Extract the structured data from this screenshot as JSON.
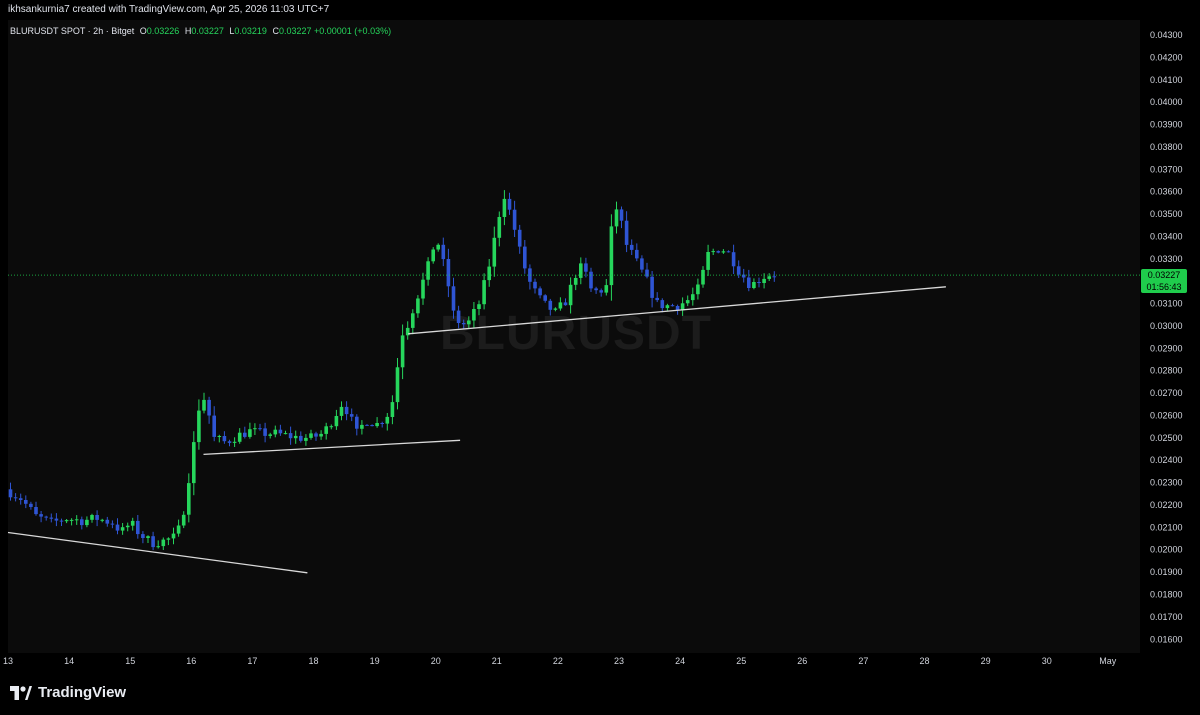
{
  "header": {
    "credit": "ikhsankurnia7 created with TradingView.com, Apr 25, 2026 11:03 UTC+7"
  },
  "legend": {
    "symbol": "BLURUSDT SPOT · 2h · Bitget",
    "open_label": "O",
    "open": "0.03226",
    "high_label": "H",
    "high": "0.03227",
    "low_label": "L",
    "low": "0.03219",
    "close_label": "C",
    "close": "0.03227",
    "change": "+0.00001 (+0.03%)"
  },
  "watermark": "BLURUSDT",
  "price_tag": {
    "price": "0.03227",
    "countdown": "01:56:43"
  },
  "footer": {
    "brand": "TradingView"
  },
  "colors": {
    "up": "#26d65c",
    "down": "#2f55d4",
    "trendline": "#d9d9d9",
    "last_price_line": "#1fcc4c",
    "background": "#0b0b0b"
  },
  "chart_data": {
    "type": "candlestick",
    "title": "BLURUSDT SPOT · 2h · Bitget",
    "xlabel": "",
    "ylabel": "",
    "ylim": [
      0.0155,
      0.0436
    ],
    "y_ticks": [
      "0.04300",
      "0.04200",
      "0.04100",
      "0.04000",
      "0.03900",
      "0.03800",
      "0.03700",
      "0.03600",
      "0.03500",
      "0.03400",
      "0.03300",
      "0.03200",
      "0.03100",
      "0.03000",
      "0.02900",
      "0.02800",
      "0.02700",
      "0.02600",
      "0.02500",
      "0.02400",
      "0.02300",
      "0.02200",
      "0.02100",
      "0.02000",
      "0.01900",
      "0.01800",
      "0.01700",
      "0.01600"
    ],
    "x_ticks": [
      {
        "label": "13",
        "day": 13
      },
      {
        "label": "14",
        "day": 14
      },
      {
        "label": "15",
        "day": 15
      },
      {
        "label": "16",
        "day": 16
      },
      {
        "label": "17",
        "day": 17
      },
      {
        "label": "18",
        "day": 18
      },
      {
        "label": "19",
        "day": 19
      },
      {
        "label": "20",
        "day": 20
      },
      {
        "label": "21",
        "day": 21
      },
      {
        "label": "22",
        "day": 22
      },
      {
        "label": "23",
        "day": 23
      },
      {
        "label": "24",
        "day": 24
      },
      {
        "label": "25",
        "day": 25
      },
      {
        "label": "26",
        "day": 26
      },
      {
        "label": "27",
        "day": 27
      },
      {
        "label": "28",
        "day": 28
      },
      {
        "label": "29",
        "day": 29
      },
      {
        "label": "30",
        "day": 30
      },
      {
        "label": "May",
        "day": 31
      }
    ],
    "last_price": 0.03227,
    "anchors": [
      [
        13.0,
        0.0227
      ],
      [
        13.25,
        0.0223
      ],
      [
        13.5,
        0.0215
      ],
      [
        13.75,
        0.0212
      ],
      [
        14.0,
        0.0214
      ],
      [
        14.25,
        0.0213
      ],
      [
        14.5,
        0.0214
      ],
      [
        14.75,
        0.0212
      ],
      [
        14.9,
        0.0208
      ],
      [
        15.05,
        0.0212
      ],
      [
        15.2,
        0.0207
      ],
      [
        15.4,
        0.0203
      ],
      [
        15.6,
        0.0204
      ],
      [
        15.8,
        0.0206
      ],
      [
        15.9,
        0.0215
      ],
      [
        16.0,
        0.0232
      ],
      [
        16.1,
        0.025
      ],
      [
        16.2,
        0.027
      ],
      [
        16.3,
        0.0265
      ],
      [
        16.4,
        0.025
      ],
      [
        16.6,
        0.0248
      ],
      [
        16.8,
        0.0251
      ],
      [
        17.0,
        0.0253
      ],
      [
        17.2,
        0.0252
      ],
      [
        17.4,
        0.0252
      ],
      [
        17.6,
        0.0251
      ],
      [
        17.8,
        0.025
      ],
      [
        18.0,
        0.025
      ],
      [
        18.2,
        0.0252
      ],
      [
        18.35,
        0.0258
      ],
      [
        18.5,
        0.0265
      ],
      [
        18.6,
        0.0262
      ],
      [
        18.75,
        0.0252
      ],
      [
        18.9,
        0.0258
      ],
      [
        19.1,
        0.0256
      ],
      [
        19.3,
        0.0262
      ],
      [
        19.4,
        0.0275
      ],
      [
        19.45,
        0.0296
      ],
      [
        19.55,
        0.0298
      ],
      [
        19.7,
        0.031
      ],
      [
        19.9,
        0.0325
      ],
      [
        20.05,
        0.034
      ],
      [
        20.15,
        0.033
      ],
      [
        20.25,
        0.0318
      ],
      [
        20.35,
        0.0303
      ],
      [
        20.55,
        0.03
      ],
      [
        20.75,
        0.031
      ],
      [
        20.9,
        0.0325
      ],
      [
        21.05,
        0.0345
      ],
      [
        21.15,
        0.036
      ],
      [
        21.3,
        0.0347
      ],
      [
        21.45,
        0.033
      ],
      [
        21.6,
        0.0318
      ],
      [
        21.8,
        0.031
      ],
      [
        22.0,
        0.0306
      ],
      [
        22.2,
        0.0312
      ],
      [
        22.3,
        0.0322
      ],
      [
        22.45,
        0.0327
      ],
      [
        22.6,
        0.0315
      ],
      [
        22.75,
        0.0316
      ],
      [
        22.85,
        0.0318
      ],
      [
        22.95,
        0.0355
      ],
      [
        23.05,
        0.035
      ],
      [
        23.15,
        0.0337
      ],
      [
        23.3,
        0.033
      ],
      [
        23.5,
        0.032
      ],
      [
        23.65,
        0.031
      ],
      [
        23.8,
        0.0309
      ],
      [
        24.0,
        0.0309
      ],
      [
        24.2,
        0.0312
      ],
      [
        24.35,
        0.0317
      ],
      [
        24.5,
        0.0332
      ],
      [
        24.7,
        0.0335
      ],
      [
        24.85,
        0.0332
      ],
      [
        25.0,
        0.0325
      ],
      [
        25.2,
        0.0318
      ],
      [
        25.4,
        0.0322
      ],
      [
        25.5,
        0.0323
      ]
    ],
    "trendlines": [
      {
        "x1": 13.0,
        "y1": 0.02077,
        "x2": 17.9,
        "y2": 0.01897
      },
      {
        "x1": 16.2,
        "y1": 0.02426,
        "x2": 20.4,
        "y2": 0.02489
      },
      {
        "x1": 19.55,
        "y1": 0.02965,
        "x2": 28.35,
        "y2": 0.03175
      }
    ]
  }
}
